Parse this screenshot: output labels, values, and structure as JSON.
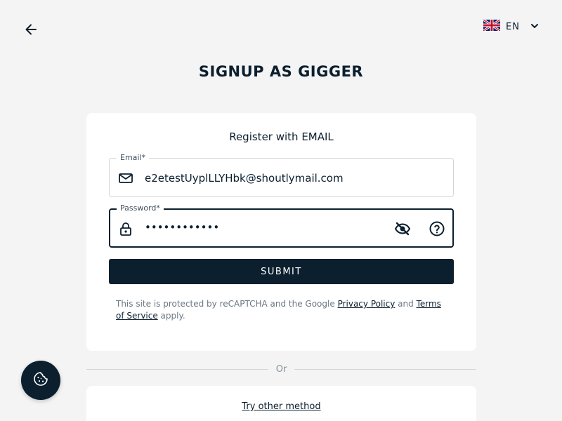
{
  "header": {
    "back_icon": "arrow-left-icon",
    "language": {
      "flag": "uk-flag-icon",
      "code": "EN",
      "chevron": "chevron-down-icon"
    }
  },
  "page_title": "SIGNUP AS GIGGER",
  "form": {
    "title": "Register with EMAIL",
    "email": {
      "label": "Email*",
      "value": "e2etestUyplLLYHbk@shoutlymail.com",
      "icon": "mail-icon"
    },
    "password": {
      "label": "Password*",
      "value": "••••••••••••",
      "icon": "lock-icon",
      "visibility_icon": "eye-off-icon",
      "help_icon": "help-circle-icon"
    },
    "submit_label": "SUBMIT",
    "recaptcha": {
      "prefix": "This site is protected by reCAPTCHA and the Google ",
      "privacy_link": "Privacy Policy",
      "and": " and ",
      "terms_link": "Terms of Service",
      "suffix": " apply."
    }
  },
  "divider_text": "Or",
  "other_method_link": "Try other method",
  "cookie_icon": "cookie-icon",
  "colors": {
    "primary": "#0b1f2e",
    "background": "#f4f4f4",
    "card": "#ffffff"
  }
}
